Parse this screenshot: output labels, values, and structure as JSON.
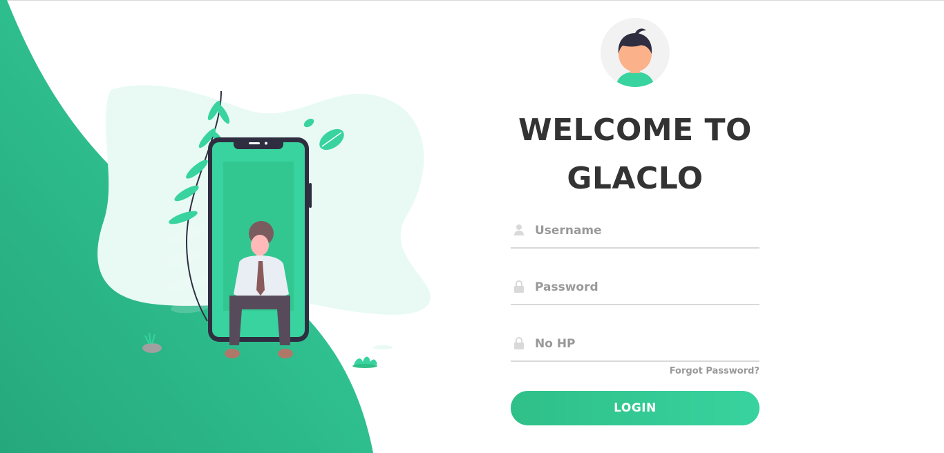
{
  "welcome": {
    "title_line1": "WELCOME TO",
    "title_line2": "GLACLO"
  },
  "form": {
    "username_placeholder": "Username",
    "username_value": "",
    "password_placeholder": "Password",
    "password_value": "",
    "nohp_placeholder": "No HP",
    "nohp_value": "",
    "forgot_label": "Forgot Password?",
    "login_label": "LOGIN"
  },
  "icons": {
    "username": "user-icon",
    "password": "lock-icon",
    "nohp": "lock-icon",
    "avatar": "avatar-icon"
  },
  "colors": {
    "accent": "#38d39f",
    "accent_dark": "#2fbf88",
    "title": "#333333",
    "muted": "#999999",
    "underline": "#d9d9d9"
  }
}
